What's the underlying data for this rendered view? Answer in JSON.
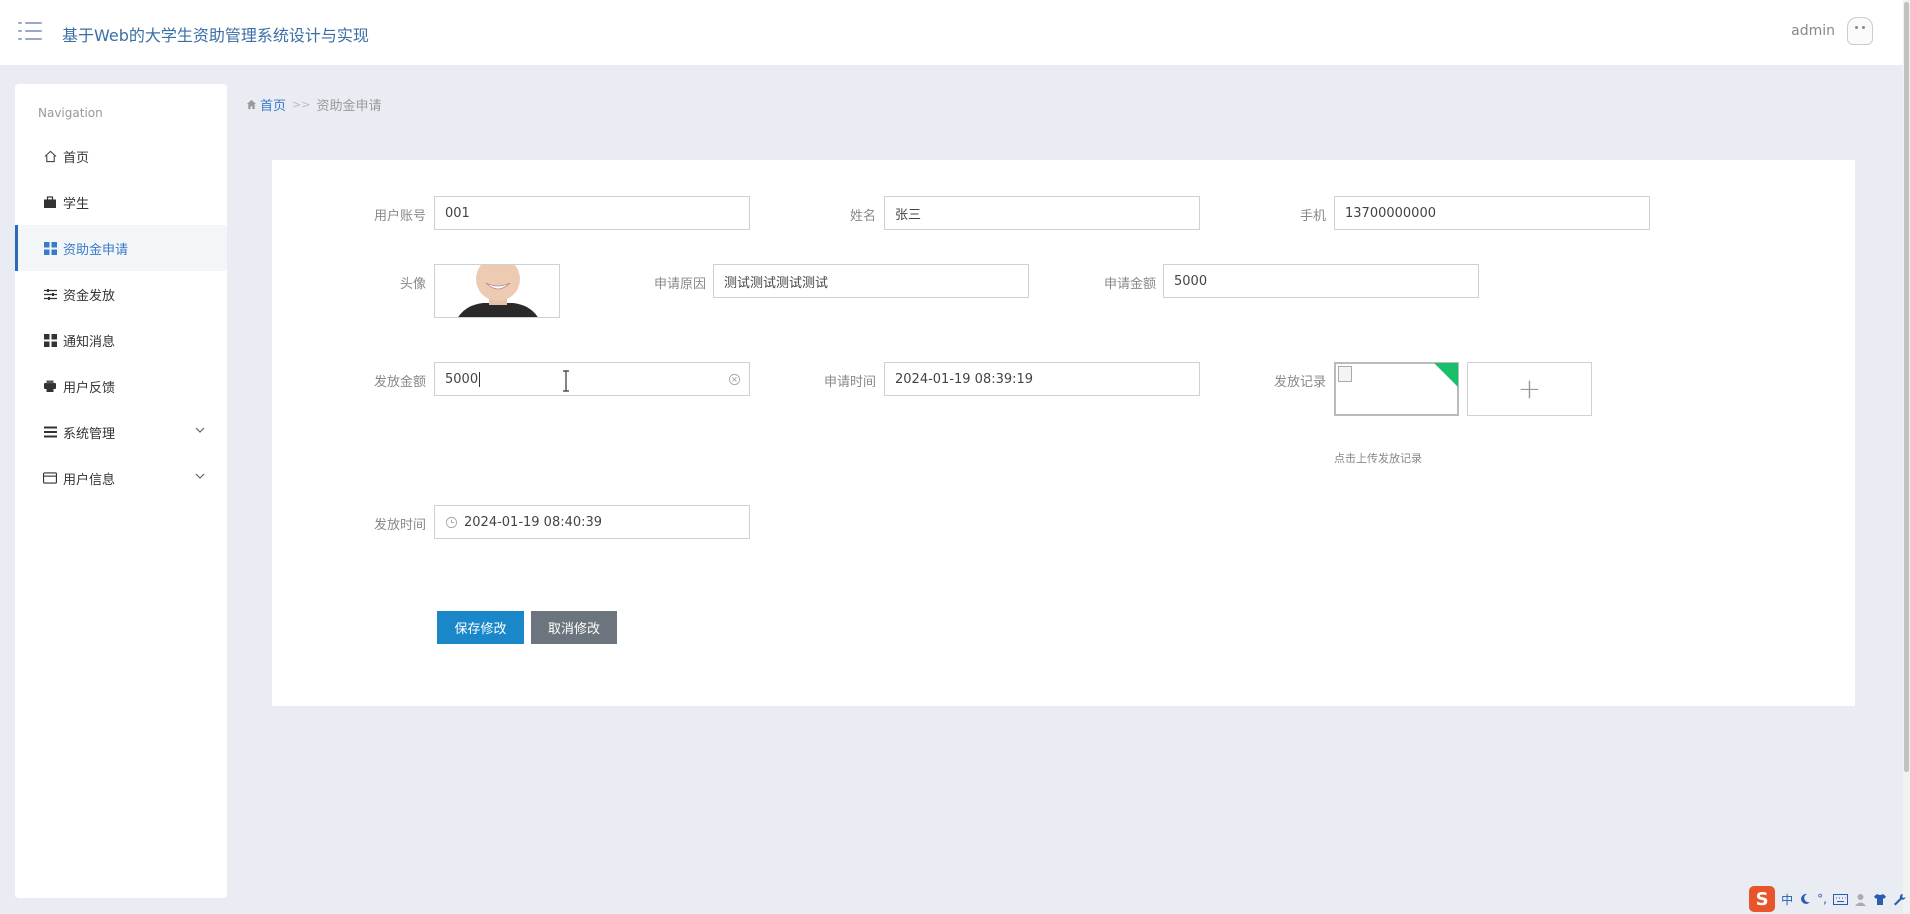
{
  "header": {
    "title": "基于Web的大学生资助管理系统设计与实现",
    "user": "admin"
  },
  "sidebar": {
    "heading": "Navigation",
    "items": [
      {
        "label": "首页",
        "icon": "home-icon"
      },
      {
        "label": "学生",
        "icon": "briefcase-icon"
      },
      {
        "label": "资助金申请",
        "icon": "grid-icon",
        "active": true
      },
      {
        "label": "资金发放",
        "icon": "sliders-icon"
      },
      {
        "label": "通知消息",
        "icon": "grid-icon"
      },
      {
        "label": "用户反馈",
        "icon": "printer-icon"
      },
      {
        "label": "系统管理",
        "icon": "list-icon",
        "expandable": true
      },
      {
        "label": "用户信息",
        "icon": "card-icon",
        "expandable": true
      }
    ]
  },
  "breadcrumb": {
    "home": "首页",
    "separator": ">>",
    "current": "资助金申请"
  },
  "form": {
    "account_label": "用户账号",
    "account_value": "001",
    "name_label": "姓名",
    "name_value": "张三",
    "phone_label": "手机",
    "phone_value": "13700000000",
    "avatar_label": "头像",
    "reason_label": "申请原因",
    "reason_value": "测试测试测试测试",
    "amount_label": "申请金额",
    "amount_value": "5000",
    "payout_label": "发放金额",
    "payout_value": "5000",
    "apply_time_label": "申请时间",
    "apply_time_value": "2024-01-19 08:39:19",
    "record_label": "发放记录",
    "record_hint": "点击上传发放记录",
    "payout_time_label": "发放时间",
    "payout_time_value": "2024-01-19 08:40:39",
    "upload_plus": "+"
  },
  "buttons": {
    "save": "保存修改",
    "cancel": "取消修改"
  },
  "tray": {
    "logo": "S",
    "ime": "中",
    "punct": "°,"
  },
  "colors": {
    "primary": "#1a87c9",
    "secondary": "#6c757d",
    "accent_green": "#19c06b",
    "title": "#3a6ea5"
  }
}
